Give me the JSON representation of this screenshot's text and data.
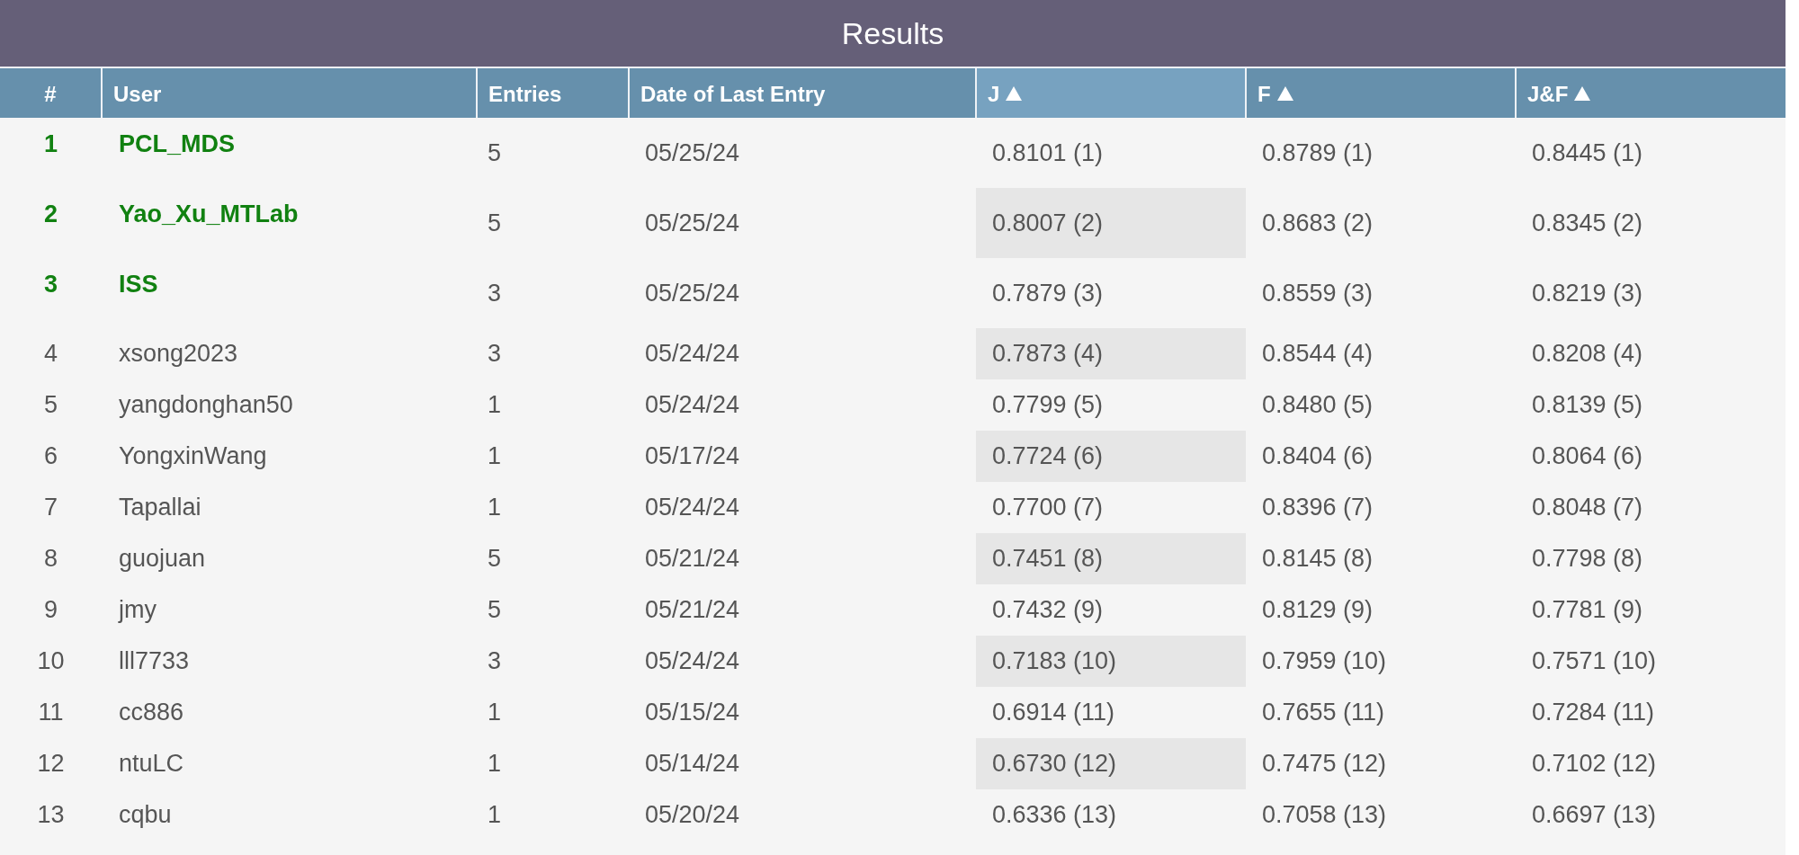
{
  "title": "Results",
  "columns": [
    {
      "label": "#",
      "sort_arrow": false,
      "sorted": false
    },
    {
      "label": "User",
      "sort_arrow": false,
      "sorted": false
    },
    {
      "label": "Entries",
      "sort_arrow": false,
      "sorted": false
    },
    {
      "label": "Date of Last Entry",
      "sort_arrow": false,
      "sorted": false
    },
    {
      "label": "J",
      "sort_arrow": true,
      "sorted": true
    },
    {
      "label": "F",
      "sort_arrow": true,
      "sorted": false
    },
    {
      "label": "J&F",
      "sort_arrow": true,
      "sorted": false
    }
  ],
  "rows": [
    {
      "rank": "1",
      "user": "PCL_MDS",
      "highlighted": true,
      "entries": "5",
      "date": "05/25/24",
      "j": "0.8101 (1)",
      "f": "0.8789 (1)",
      "jf": "0.8445 (1)"
    },
    {
      "rank": "2",
      "user": "Yao_Xu_MTLab",
      "highlighted": true,
      "entries": "5",
      "date": "05/25/24",
      "j": "0.8007 (2)",
      "f": "0.8683 (2)",
      "jf": "0.8345 (2)"
    },
    {
      "rank": "3",
      "user": "ISS",
      "highlighted": true,
      "entries": "3",
      "date": "05/25/24",
      "j": "0.7879 (3)",
      "f": "0.8559 (3)",
      "jf": "0.8219 (3)"
    },
    {
      "rank": "4",
      "user": "xsong2023",
      "highlighted": false,
      "entries": "3",
      "date": "05/24/24",
      "j": "0.7873 (4)",
      "f": "0.8544 (4)",
      "jf": "0.8208 (4)"
    },
    {
      "rank": "5",
      "user": "yangdonghan50",
      "highlighted": false,
      "entries": "1",
      "date": "05/24/24",
      "j": "0.7799 (5)",
      "f": "0.8480 (5)",
      "jf": "0.8139 (5)"
    },
    {
      "rank": "6",
      "user": "YongxinWang",
      "highlighted": false,
      "entries": "1",
      "date": "05/17/24",
      "j": "0.7724 (6)",
      "f": "0.8404 (6)",
      "jf": "0.8064 (6)"
    },
    {
      "rank": "7",
      "user": "Tapallai",
      "highlighted": false,
      "entries": "1",
      "date": "05/24/24",
      "j": "0.7700 (7)",
      "f": "0.8396 (7)",
      "jf": "0.8048 (7)"
    },
    {
      "rank": "8",
      "user": "guojuan",
      "highlighted": false,
      "entries": "5",
      "date": "05/21/24",
      "j": "0.7451 (8)",
      "f": "0.8145 (8)",
      "jf": "0.7798 (8)"
    },
    {
      "rank": "9",
      "user": "jmy",
      "highlighted": false,
      "entries": "5",
      "date": "05/21/24",
      "j": "0.7432 (9)",
      "f": "0.8129 (9)",
      "jf": "0.7781 (9)"
    },
    {
      "rank": "10",
      "user": "lll7733",
      "highlighted": false,
      "entries": "3",
      "date": "05/24/24",
      "j": "0.7183 (10)",
      "f": "0.7959 (10)",
      "jf": "0.7571 (10)"
    },
    {
      "rank": "11",
      "user": "cc886",
      "highlighted": false,
      "entries": "1",
      "date": "05/15/24",
      "j": "0.6914 (11)",
      "f": "0.7655 (11)",
      "jf": "0.7284 (11)"
    },
    {
      "rank": "12",
      "user": "ntuLC",
      "highlighted": false,
      "entries": "1",
      "date": "05/14/24",
      "j": "0.6730 (12)",
      "f": "0.7475 (12)",
      "jf": "0.7102 (12)"
    },
    {
      "rank": "13",
      "user": "cqbu",
      "highlighted": false,
      "entries": "1",
      "date": "05/20/24",
      "j": "0.6336 (13)",
      "f": "0.7058 (13)",
      "jf": "0.6697 (13)"
    }
  ]
}
